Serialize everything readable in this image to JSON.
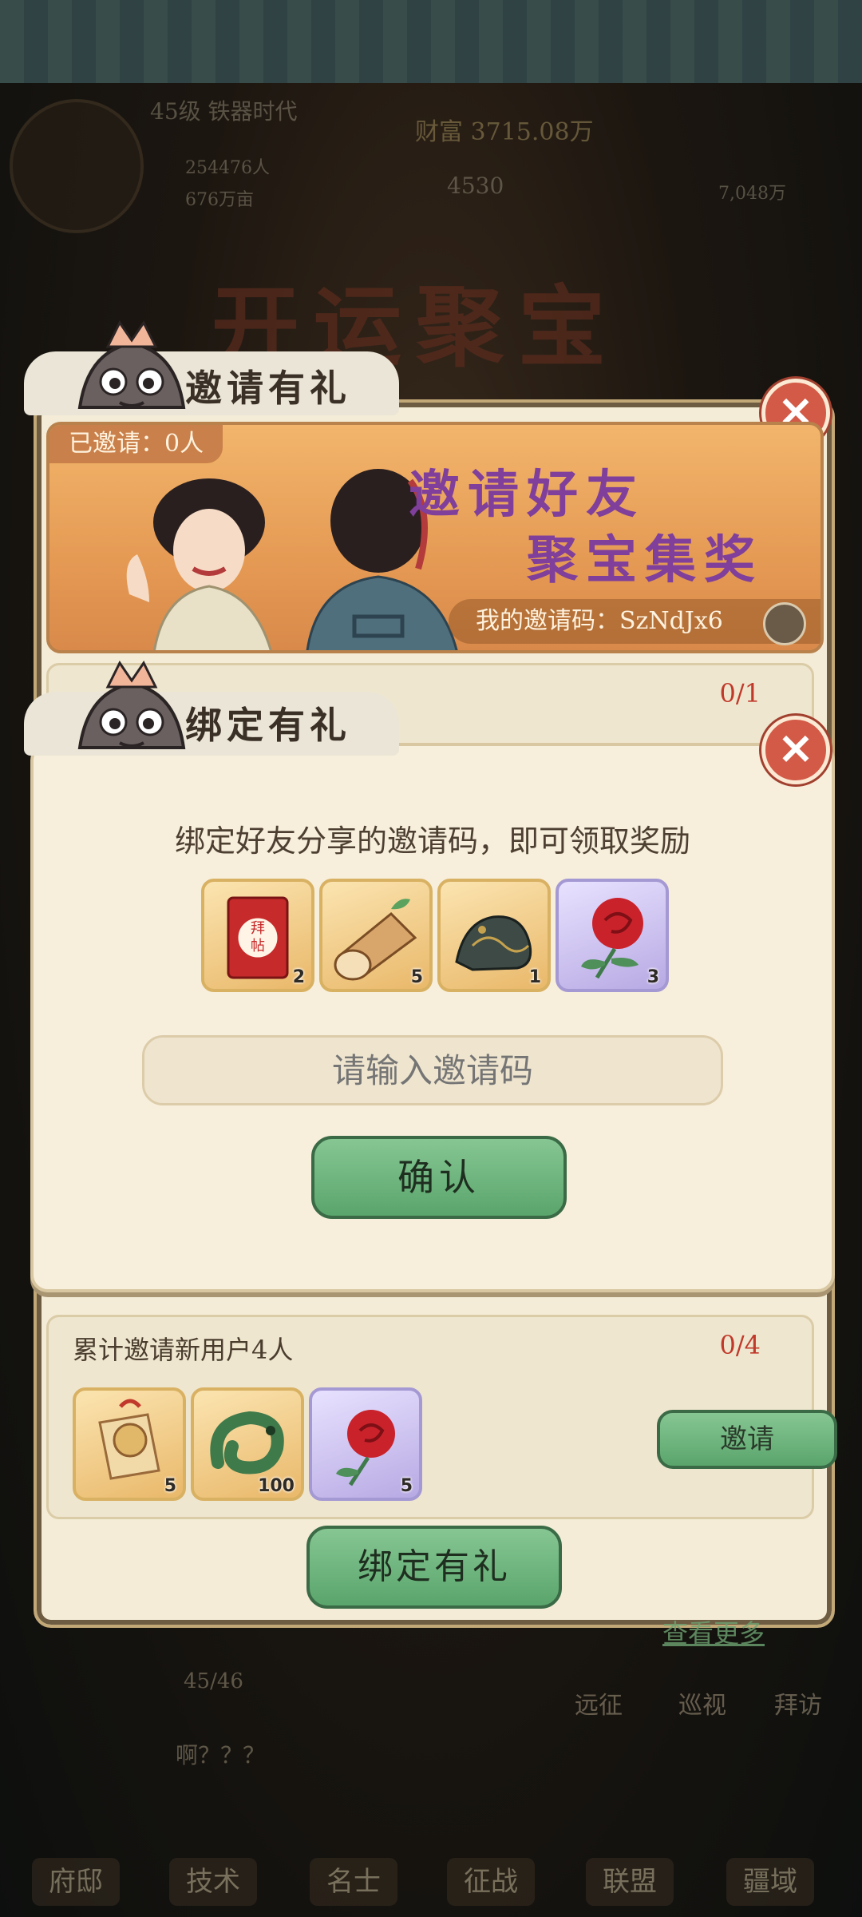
{
  "hud": {
    "level": "45级 铁器时代",
    "stat1": "254476人",
    "stat2": "676万亩",
    "gold": "财富 3715.08万",
    "grain": "4530",
    "food": "7,048万"
  },
  "game_title": "开运聚宝",
  "invite_panel": {
    "title": "邀请有礼",
    "banner": {
      "invited_count": "已邀请：0人",
      "headline_line1": "邀请好友",
      "headline_line2": "聚宝集奖",
      "my_code": "我的邀请码：SzNdJx6"
    },
    "task1": {
      "progress": "0/1"
    },
    "task2": {
      "title": "累计邀请新用户4人",
      "progress": "0/4",
      "rewards": [
        {
          "icon": "amulet-icon",
          "count": "5"
        },
        {
          "icon": "jade-dragon-icon",
          "count": "100"
        },
        {
          "icon": "rose-icon",
          "count": "5"
        }
      ],
      "invite_label": "邀请"
    },
    "bind_gift_label": "绑定有礼",
    "more_link": "查看更多"
  },
  "bind_dialog": {
    "title": "绑定有礼",
    "instruction": "绑定好友分享的邀请码，即可领取奖励",
    "rewards": [
      {
        "icon": "invitation-card-icon",
        "label": "拜帖",
        "count": "2"
      },
      {
        "icon": "wood-log-icon",
        "count": "5"
      },
      {
        "icon": "bronze-beast-icon",
        "count": "1"
      },
      {
        "icon": "rose-icon",
        "count": "3"
      }
    ],
    "input_placeholder": "请输入邀请码",
    "confirm_label": "确认"
  },
  "background": {
    "progress": "45/46",
    "chat": "啊？？？",
    "side_labels": [
      "远征",
      "巡视",
      "拜访"
    ],
    "nav": [
      "府邸",
      "技术",
      "名士",
      "征战",
      "联盟",
      "疆域"
    ]
  },
  "colors": {
    "panel_bg": "#f4ecd6",
    "accent_green": "#5aa56c",
    "close_red": "#d35a47",
    "headline_purple": "#7f3f9b",
    "progress_red": "#c0392b"
  }
}
